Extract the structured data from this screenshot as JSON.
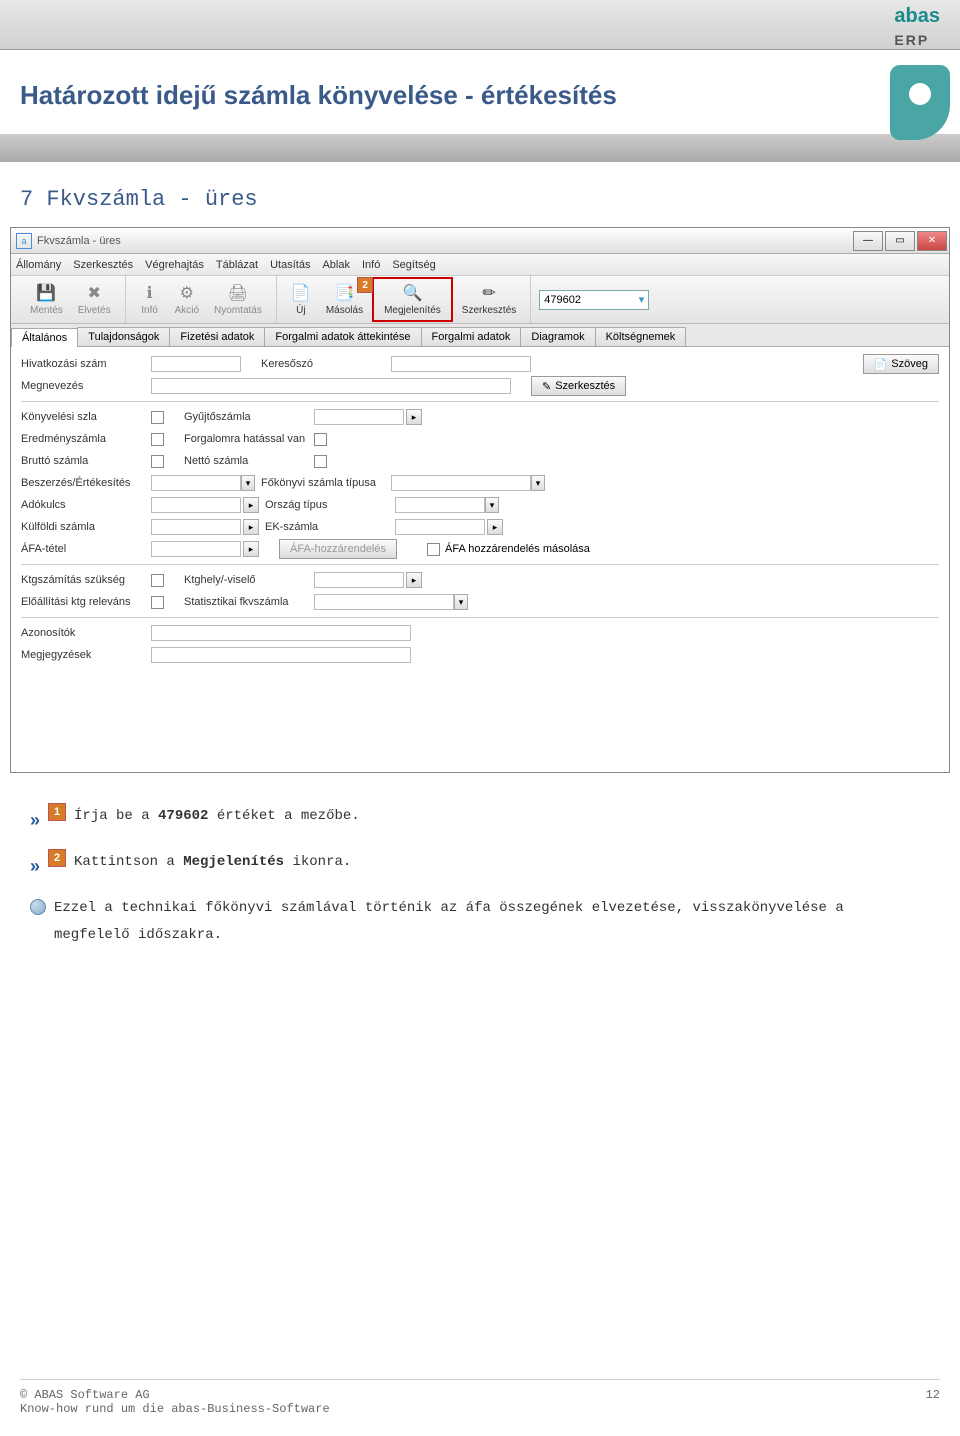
{
  "header": {
    "logo_main": "abas",
    "logo_sub": "ERP"
  },
  "title": "Határozott idejű számla könyvelése - értékesítés",
  "section_title": "7 Fkvszámla - üres",
  "window": {
    "title": "Fkvszámla - üres",
    "menus": [
      "Állomány",
      "Szerkesztés",
      "Végrehajtás",
      "Táblázat",
      "Utasítás",
      "Ablak",
      "Infó",
      "Segítség"
    ],
    "toolbar": {
      "mentes": "Mentés",
      "elvetes": "Elvetés",
      "info": "Infó",
      "akcio": "Akció",
      "nyomtatas": "Nyomtatás",
      "uj": "Új",
      "masolas": "Másolás",
      "megjelenites": "Megjelenítés",
      "szerkesztes": "Szerkesztés",
      "search_value": "479602"
    },
    "tabs": [
      "Általános",
      "Tulajdonságok",
      "Fizetési adatok",
      "Forgalmi adatok áttekintése",
      "Forgalmi adatok",
      "Diagramok",
      "Költségnemek"
    ],
    "fields": {
      "hivatkozasi_szam": "Hivatkozási szám",
      "keresoszo": "Keresőszó",
      "szoveg_btn": "Szöveg",
      "megnevezes": "Megnevezés",
      "szerkesztes_btn": "Szerkesztés",
      "konyvelesi_szla": "Könyvelési szla",
      "gyujtoszamla": "Gyűjtőszámla",
      "eredmenyszamla": "Eredményszámla",
      "forgalomra_hatassal": "Forgalomra hatással van",
      "brutto_szamla": "Bruttó számla",
      "netto_szamla": "Nettó számla",
      "beszerzes_ertekesites": "Beszerzés/Értékesítés",
      "fokonyvi_szamla_tipusa": "Főkönyvi számla típusa",
      "adokulcs": "Adókulcs",
      "orszag_tipus": "Ország típus",
      "kulfoldi_szamla": "Külföldi számla",
      "ek_szamla": "EK-számla",
      "afa_tetel": "ÁFA-tétel",
      "afa_hozzarendeles": "ÁFA-hozzárendelés",
      "afa_hozzarendeles_masolasa": "ÁFA hozzárendelés másolása",
      "ktgszamitas_szukseg": "Ktgszámítás szükség",
      "ktghely_viselo": "Ktghely/-viselő",
      "eloallitasi_ktg": "Előállítási ktg releváns",
      "statisztikai_fkvszamla": "Statisztikai fkvszámla",
      "azonositok": "Azonosítók",
      "megjegyzesek": "Megjegyzések"
    }
  },
  "steps": {
    "s1_num": "1",
    "s1_text_a": "Írja be a ",
    "s1_bold": "479602",
    "s1_text_b": " értéket a mezőbe.",
    "s2_num": "2",
    "s2_text_a": "Kattintson a ",
    "s2_bold": "Megjelenítés",
    "s2_text_b": " ikonra.",
    "note": "Ezzel a technikai főkönyvi számlával történik az áfa összegének elvezetése, visszakönyvelése a megfelelő időszakra."
  },
  "footer": {
    "copyright": "© ABAS Software AG",
    "tagline": "Know-how rund um die abas-Business-Software",
    "page": "12"
  }
}
